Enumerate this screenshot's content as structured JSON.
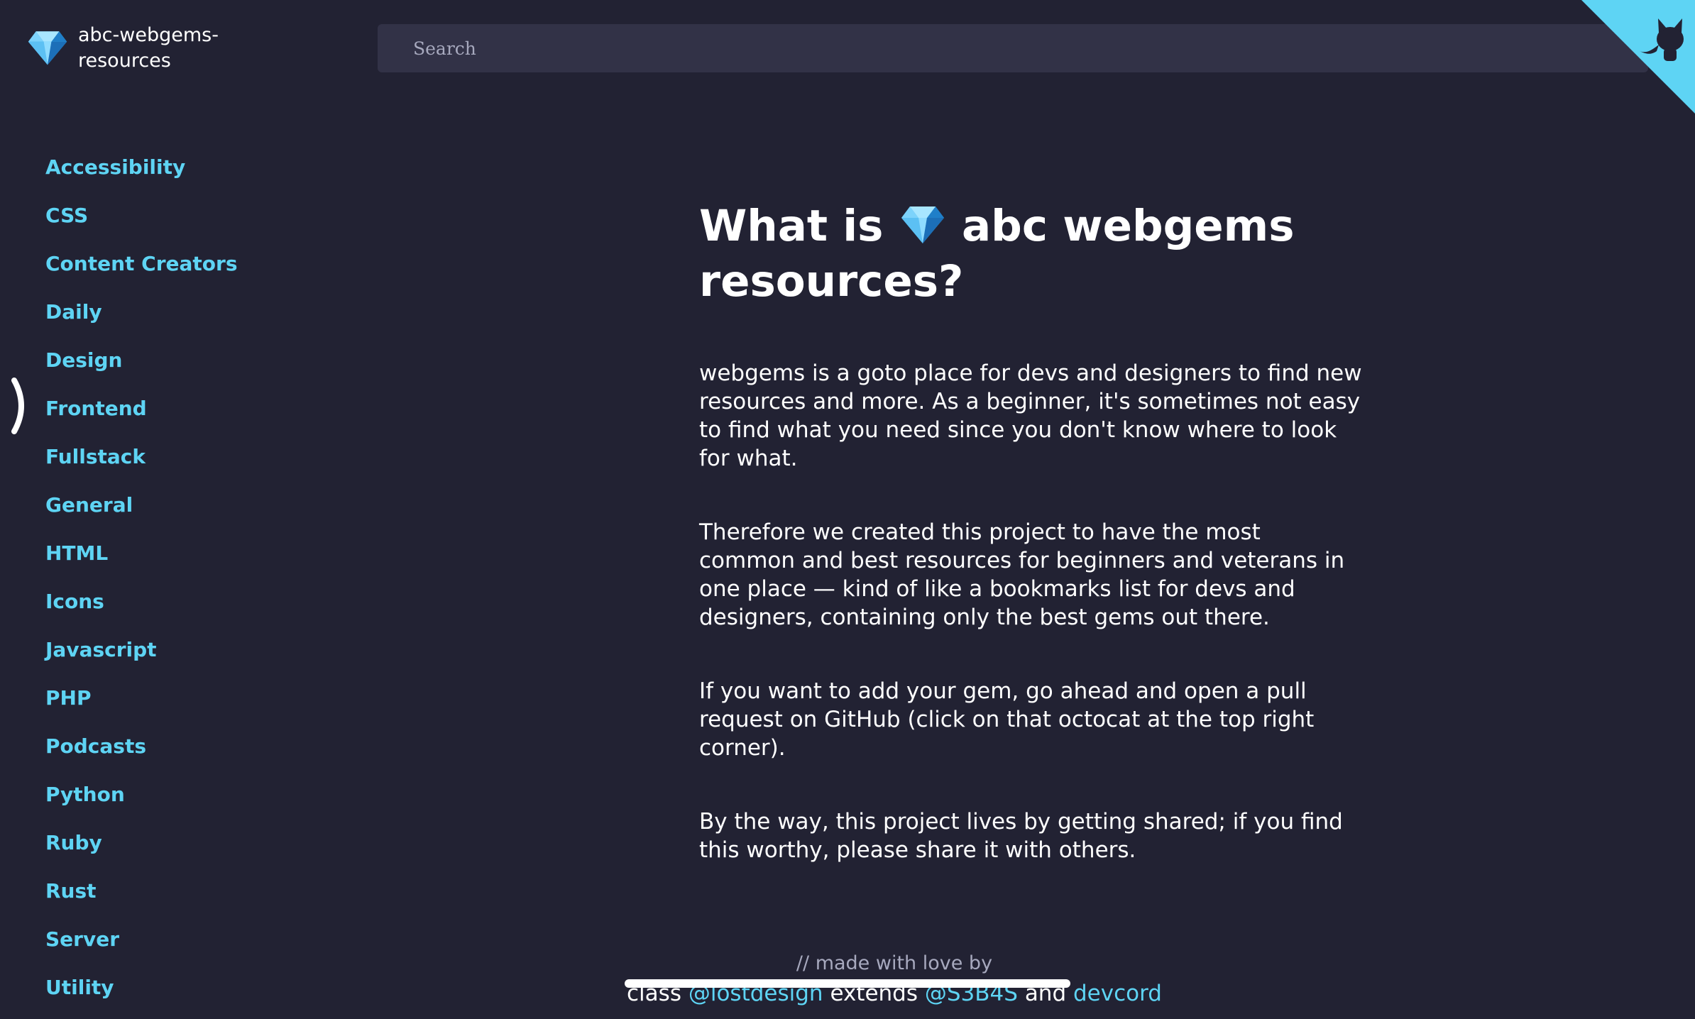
{
  "brand": {
    "name": "abc-webgems-resources",
    "icon": "gem-icon"
  },
  "search": {
    "placeholder": "Search"
  },
  "corner": {
    "icon": "octocat-icon",
    "color": "#5ed4f4"
  },
  "sidebar": {
    "items": [
      {
        "label": "Accessibility"
      },
      {
        "label": "CSS"
      },
      {
        "label": "Content Creators"
      },
      {
        "label": "Daily"
      },
      {
        "label": "Design"
      },
      {
        "label": "Frontend"
      },
      {
        "label": "Fullstack"
      },
      {
        "label": "General"
      },
      {
        "label": "HTML"
      },
      {
        "label": "Icons"
      },
      {
        "label": "Javascript"
      },
      {
        "label": "PHP"
      },
      {
        "label": "Podcasts"
      },
      {
        "label": "Python"
      },
      {
        "label": "Ruby"
      },
      {
        "label": "Rust"
      },
      {
        "label": "Server"
      },
      {
        "label": "Utility"
      }
    ],
    "toggle_icon": "chevron-right-icon"
  },
  "main": {
    "title_before": "What is",
    "title_after": "abc webgems resources?",
    "paragraphs": [
      "webgems is a goto place for devs and designers to find new resources and more. As a beginner, it's sometimes not easy to find what you need since you don't know where to look for what.",
      "Therefore we created this project to have the most common and best resources for beginners and veterans in one place — kind of like a bookmarks list for devs and designers, containing only the best gems out there.",
      "If you want to add your gem, go ahead and open a pull request on GitHub (click on that octocat at the top right corner).",
      "By the way, this project lives by getting shared; if you find this worthy, please share it with others."
    ]
  },
  "footer": {
    "note": "// made with love by",
    "class_word": "class",
    "link1": "@lostdesign",
    "extends_word": "extends",
    "link2": "@S3B4S",
    "and_word": "and",
    "link3": "devcord"
  },
  "colors": {
    "background": "#222233",
    "accent": "#5ed4f4",
    "search_bg": "#323247"
  }
}
